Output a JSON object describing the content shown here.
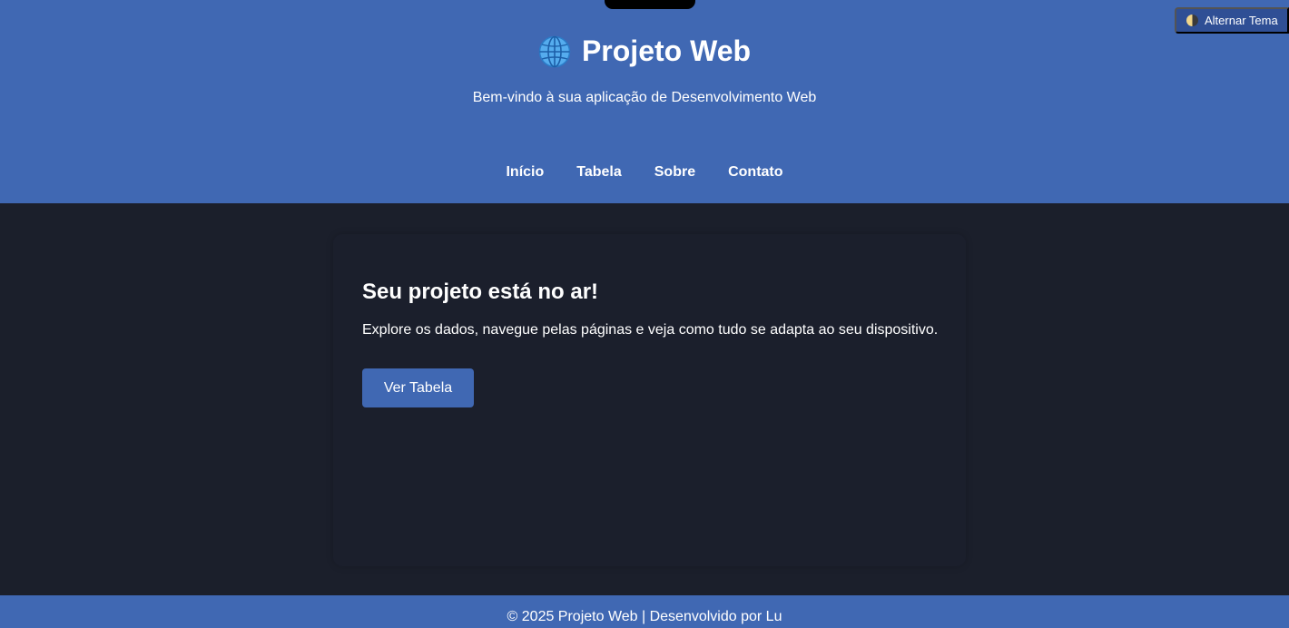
{
  "header": {
    "title": "Projeto Web",
    "title_icon": "globe-icon",
    "subtitle": "Bem-vindo à sua aplicação de Desenvolvimento Web",
    "theme_toggle_label": "Alternar Tema",
    "theme_toggle_icon": "half-moon-icon"
  },
  "nav": {
    "items": [
      {
        "label": "Início"
      },
      {
        "label": "Tabela"
      },
      {
        "label": "Sobre"
      },
      {
        "label": "Contato"
      }
    ]
  },
  "main": {
    "heading": "Seu projeto está no ar!",
    "description": "Explore os dados, navegue pelas páginas e veja como tudo se adapta ao seu dispositivo.",
    "button_label": "Ver Tabela"
  },
  "footer": {
    "text": "© 2025 Projeto Web | Desenvolvido por Lu"
  },
  "colors": {
    "header_bg": "#4068b3",
    "page_bg": "#1b1f2b",
    "button_bg": "#4068b3",
    "toggle_bg": "#2f4f95"
  }
}
